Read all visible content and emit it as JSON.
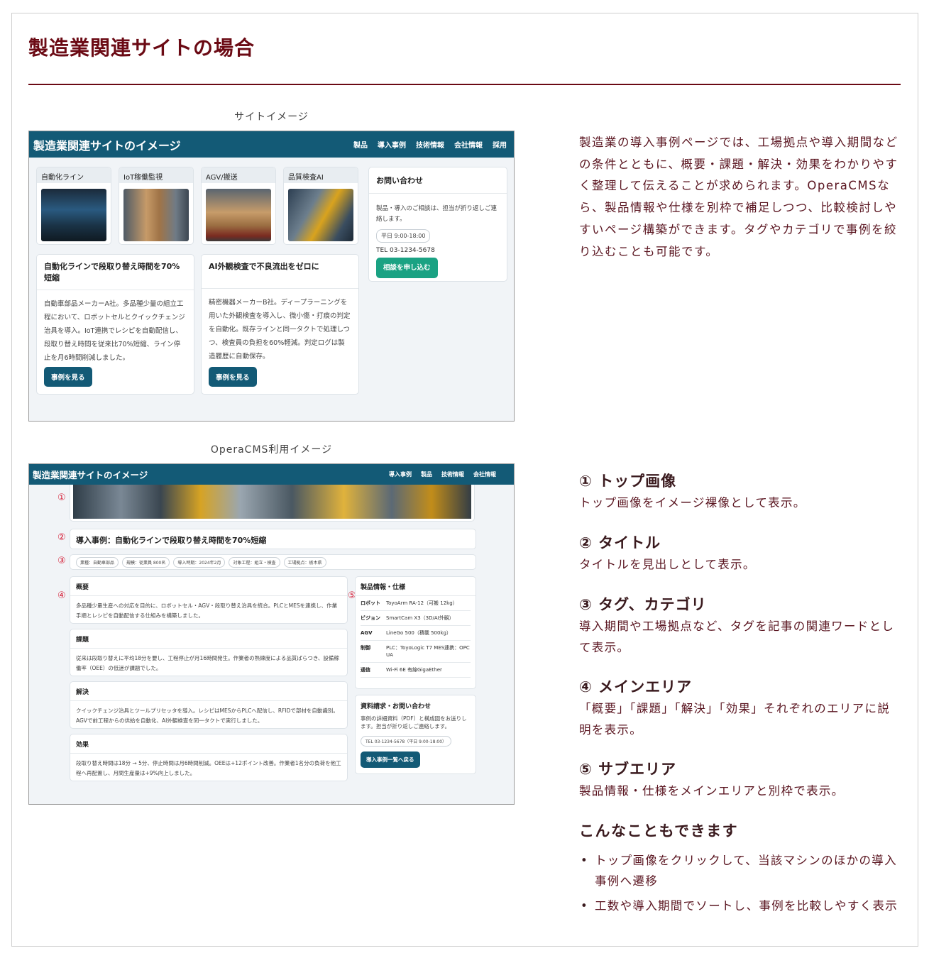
{
  "page": {
    "title": "製造業関連サイトの場合",
    "caption_site": "サイトイメージ",
    "caption_cms": "OperaCMS利用イメージ"
  },
  "site_image": {
    "brand": "製造業関連サイトのイメージ",
    "nav": [
      "製品",
      "導入事例",
      "技術情報",
      "会社情報",
      "採用"
    ],
    "categories": [
      "自動化ライン",
      "IoT稼働監視",
      "AGV/搬送",
      "品質検査AI"
    ],
    "cases": [
      {
        "title": "自動化ラインで段取り替え時間を70%短縮",
        "body": "自動車部品メーカーA社。多品種少量の組立工程において、ロボットセルとクイックチェンジ治具を導入。IoT連携でレシピを自動配信し、段取り替え時間を従来比70%短縮、ライン停止を月6時間削減しました。",
        "button": "事例を見る"
      },
      {
        "title": "AI外観検査で不良流出をゼロに",
        "body": "精密機器メーカーB社。ディープラーニングを用いた外観検査を導入し、微小傷・打痕の判定を自動化。既存ラインと同一タクトで処理しつつ、検査員の負担を60%軽減。判定ログは製造履歴に自動保存。",
        "button": "事例を見る"
      }
    ],
    "contact": {
      "title": "お問い合わせ",
      "body": "製品・導入のご相談は、担当が折り返しご連絡します。",
      "hours": "平日 9:00-18:00",
      "tel": "TEL 03-1234-5678",
      "button": "相談を申し込む"
    }
  },
  "cms_image": {
    "brand": "製造業関連サイトのイメージ",
    "nav": [
      "導入事例",
      "製品",
      "技術情報",
      "会社情報"
    ],
    "markers": [
      "①",
      "②",
      "③",
      "④",
      "⑤"
    ],
    "title": "導入事例：自動化ラインで段取り替え時間を70%短縮",
    "tags": [
      "業種：自動車部品",
      "規模：従業員 800名",
      "導入時期：2024年2月",
      "対象工程：組立・検査",
      "工場拠点：栃木県"
    ],
    "sections": [
      {
        "head": "概要",
        "body": "多品種少量生産への対応を目的に、ロボットセル・AGV・段取り替え治具を統合。PLCとMESを連携し、作業手順とレシピを自動配信する仕組みを構築しました。"
      },
      {
        "head": "課題",
        "body": "従来は段取り替えに平均18分を要し、工程停止が月16時間発生。作業者の熟練度による品質ばらつき、設備稼働率（OEE）の低迷が課題でした。"
      },
      {
        "head": "解決",
        "body": "クイックチェンジ治具とツールプリセッタを導入。レシピはMESからPLCへ配信し、RFIDで部材を自動識別。AGVで前工程からの供給を自動化、AI外観検査を同一タクトで実行しました。"
      },
      {
        "head": "効果",
        "body": "段取り替え時間は18分 → 5分、停止時間は月6時間削減。OEEは+12ポイント改善。作業者1名分の負荷を他工程へ再配置し、月間生産量は+9%向上しました。"
      }
    ],
    "spec": {
      "title": "製品情報・仕様",
      "rows": [
        {
          "k": "ロボット",
          "v": "ToyoArm RA-12（可搬 12kg）"
        },
        {
          "k": "ビジョン",
          "v": "SmartCam X3（3D/AI外観）"
        },
        {
          "k": "AGV",
          "v": "LineGo 500（積載 500kg）"
        },
        {
          "k": "制御",
          "v": "PLC：ToyoLogic T7 MES連携：OPC UA"
        },
        {
          "k": "通信",
          "v": "Wi-Fi 6E 有線GigaEther"
        }
      ]
    },
    "request": {
      "title": "資料請求・お問い合わせ",
      "body": "事例の詳細資料（PDF）と構成図をお送りします。担当が折り返しご連絡します。",
      "tel": "TEL 03-1234-5678（平日 9:00-18:00）",
      "button": "導入事例一覧へ戻る"
    }
  },
  "intro": "製造業の導入事例ページでは、工場拠点や導入期間などの条件とともに、概要・課題・解決・効果をわかりやすく整理して伝えることが求められます。OperaCMSなら、製品情報や仕様を別枠で補足しつつ、比較検討しやすいページ構築ができます。タグやカテゴリで事例を絞り込むことも可能です。",
  "features": [
    {
      "head": "① トップ画像",
      "body": "トップ画像をイメージ裸像として表示。"
    },
    {
      "head": "② タイトル",
      "body": "タイトルを見出しとして表示。"
    },
    {
      "head": "③ タグ、カテゴリ",
      "body": "導入期間や工場拠点など、タグを記事の関連ワードとして表示。"
    },
    {
      "head": "④ メインエリア",
      "body": "「概要」「課題」「解決」「効果」それぞれのエリアに説明を表示。"
    },
    {
      "head": "⑤ サブエリア",
      "body": "製品情報・仕様をメインエリアと別枠で表示。"
    }
  ],
  "more": {
    "title": "こんなこともできます",
    "items": [
      "トップ画像をクリックして、当該マシンのほかの導入事例へ遷移",
      "工数や導入期間でソートし、事例を比較しやすく表示"
    ]
  }
}
